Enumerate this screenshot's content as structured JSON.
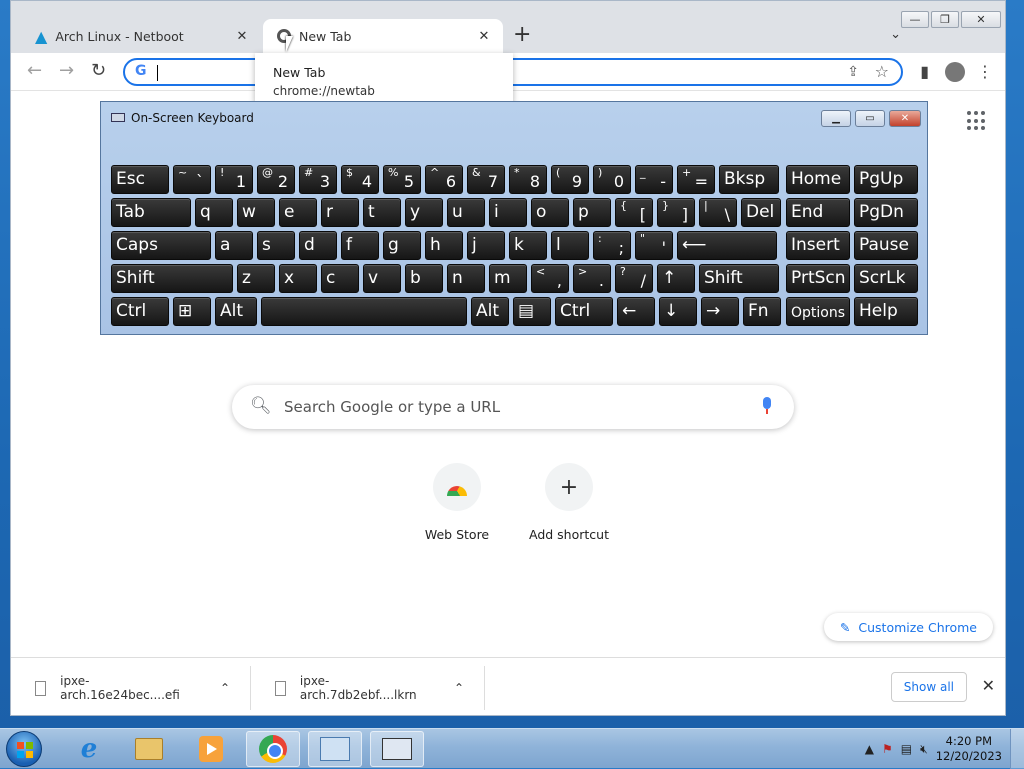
{
  "chrome": {
    "tabs": [
      {
        "title": "Arch Linux - Netboot",
        "close": "✕",
        "icon": "arch-logo-icon"
      },
      {
        "title": "New Tab",
        "close": "✕",
        "icon": "chrome-tab-icon"
      }
    ],
    "new_tab_symbol": "+",
    "tab_search_symbol": "⌄",
    "window_controls": {
      "minimize": "—",
      "maximize": "❐",
      "close": "✕"
    },
    "tooltip": {
      "title": "New Tab",
      "url": "chrome://newtab"
    },
    "toolbar": {
      "back": "←",
      "forward": "→",
      "reload": "↻",
      "omnibox_google": "G",
      "share": "⇪",
      "star": "☆",
      "side_panel": "▮",
      "menu": "⋮"
    },
    "ntp": {
      "search_placeholder": "Search Google or type a URL",
      "shortcuts": [
        {
          "label": "Web Store",
          "icon": "web-store-icon"
        },
        {
          "label": "Add shortcut",
          "icon": "plus-icon",
          "symbol": "+"
        }
      ],
      "customize_label": "Customize Chrome",
      "customize_icon": "✎"
    },
    "downloads": {
      "items": [
        {
          "name": "ipxe-arch.16e24bec....efi"
        },
        {
          "name": "ipxe-arch.7db2ebf....lkrn"
        }
      ],
      "chevron": "⌃",
      "show_all": "Show all",
      "close": "✕"
    }
  },
  "osk": {
    "title": "On-Screen Keyboard",
    "controls": {
      "minimize": "▁",
      "maximize": "▭",
      "close": "✕"
    },
    "rows": [
      [
        {
          "main": "Esc",
          "w": 1
        },
        {
          "shift": "~",
          "base": "`"
        },
        {
          "shift": "!",
          "base": "1"
        },
        {
          "shift": "@",
          "base": "2"
        },
        {
          "shift": "#",
          "base": "3"
        },
        {
          "shift": "$",
          "base": "4"
        },
        {
          "shift": "%",
          "base": "5"
        },
        {
          "shift": "^",
          "base": "6"
        },
        {
          "shift": "&",
          "base": "7"
        },
        {
          "shift": "*",
          "base": "8"
        },
        {
          "shift": "(",
          "base": "9"
        },
        {
          "shift": ")",
          "base": "0"
        },
        {
          "shift": "_",
          "base": "-"
        },
        {
          "shift": "+",
          "base": "="
        },
        {
          "main": "Bksp"
        },
        {
          "main": "Home"
        },
        {
          "main": "PgUp"
        }
      ],
      [
        {
          "main": "Tab"
        },
        {
          "main": "q"
        },
        {
          "main": "w"
        },
        {
          "main": "e"
        },
        {
          "main": "r"
        },
        {
          "main": "t"
        },
        {
          "main": "y"
        },
        {
          "main": "u"
        },
        {
          "main": "i"
        },
        {
          "main": "o"
        },
        {
          "main": "p"
        },
        {
          "shift": "{",
          "base": "["
        },
        {
          "shift": "}",
          "base": "]"
        },
        {
          "shift": "|",
          "base": "\\"
        },
        {
          "main": "Del"
        },
        {
          "main": "End"
        },
        {
          "main": "PgDn"
        }
      ],
      [
        {
          "main": "Caps"
        },
        {
          "main": "a"
        },
        {
          "main": "s"
        },
        {
          "main": "d"
        },
        {
          "main": "f"
        },
        {
          "main": "g"
        },
        {
          "main": "h"
        },
        {
          "main": "j"
        },
        {
          "main": "k"
        },
        {
          "main": "l"
        },
        {
          "shift": ":",
          "base": ";"
        },
        {
          "shift": "\"",
          "base": "'"
        },
        {
          "main": "⟵"
        },
        {
          "main": "Insert"
        },
        {
          "main": "Pause"
        }
      ],
      [
        {
          "main": "Shift"
        },
        {
          "main": "z"
        },
        {
          "main": "x"
        },
        {
          "main": "c"
        },
        {
          "main": "v"
        },
        {
          "main": "b"
        },
        {
          "main": "n"
        },
        {
          "main": "m"
        },
        {
          "shift": "<",
          "base": ","
        },
        {
          "shift": ">",
          "base": "."
        },
        {
          "shift": "?",
          "base": "/"
        },
        {
          "main": "↑"
        },
        {
          "main": "Shift"
        },
        {
          "main": "PrtScn"
        },
        {
          "main": "ScrLk"
        }
      ],
      [
        {
          "main": "Ctrl"
        },
        {
          "main": "⊞"
        },
        {
          "main": "Alt"
        },
        {
          "main": ""
        },
        {
          "main": "Alt"
        },
        {
          "main": "▤"
        },
        {
          "main": "Ctrl"
        },
        {
          "main": "←"
        },
        {
          "main": "↓"
        },
        {
          "main": "→"
        },
        {
          "main": "Fn"
        },
        {
          "main": "Options"
        },
        {
          "main": "Help"
        }
      ]
    ]
  },
  "taskbar": {
    "apps": [
      {
        "name": "internet-explorer",
        "glyph": "e"
      },
      {
        "name": "file-explorer"
      },
      {
        "name": "media-player"
      },
      {
        "name": "google-chrome"
      },
      {
        "name": "control-panel"
      },
      {
        "name": "on-screen-keyboard"
      }
    ],
    "tray_arrow": "▲",
    "clock": {
      "time": "4:20 PM",
      "date": "12/20/2023"
    }
  }
}
